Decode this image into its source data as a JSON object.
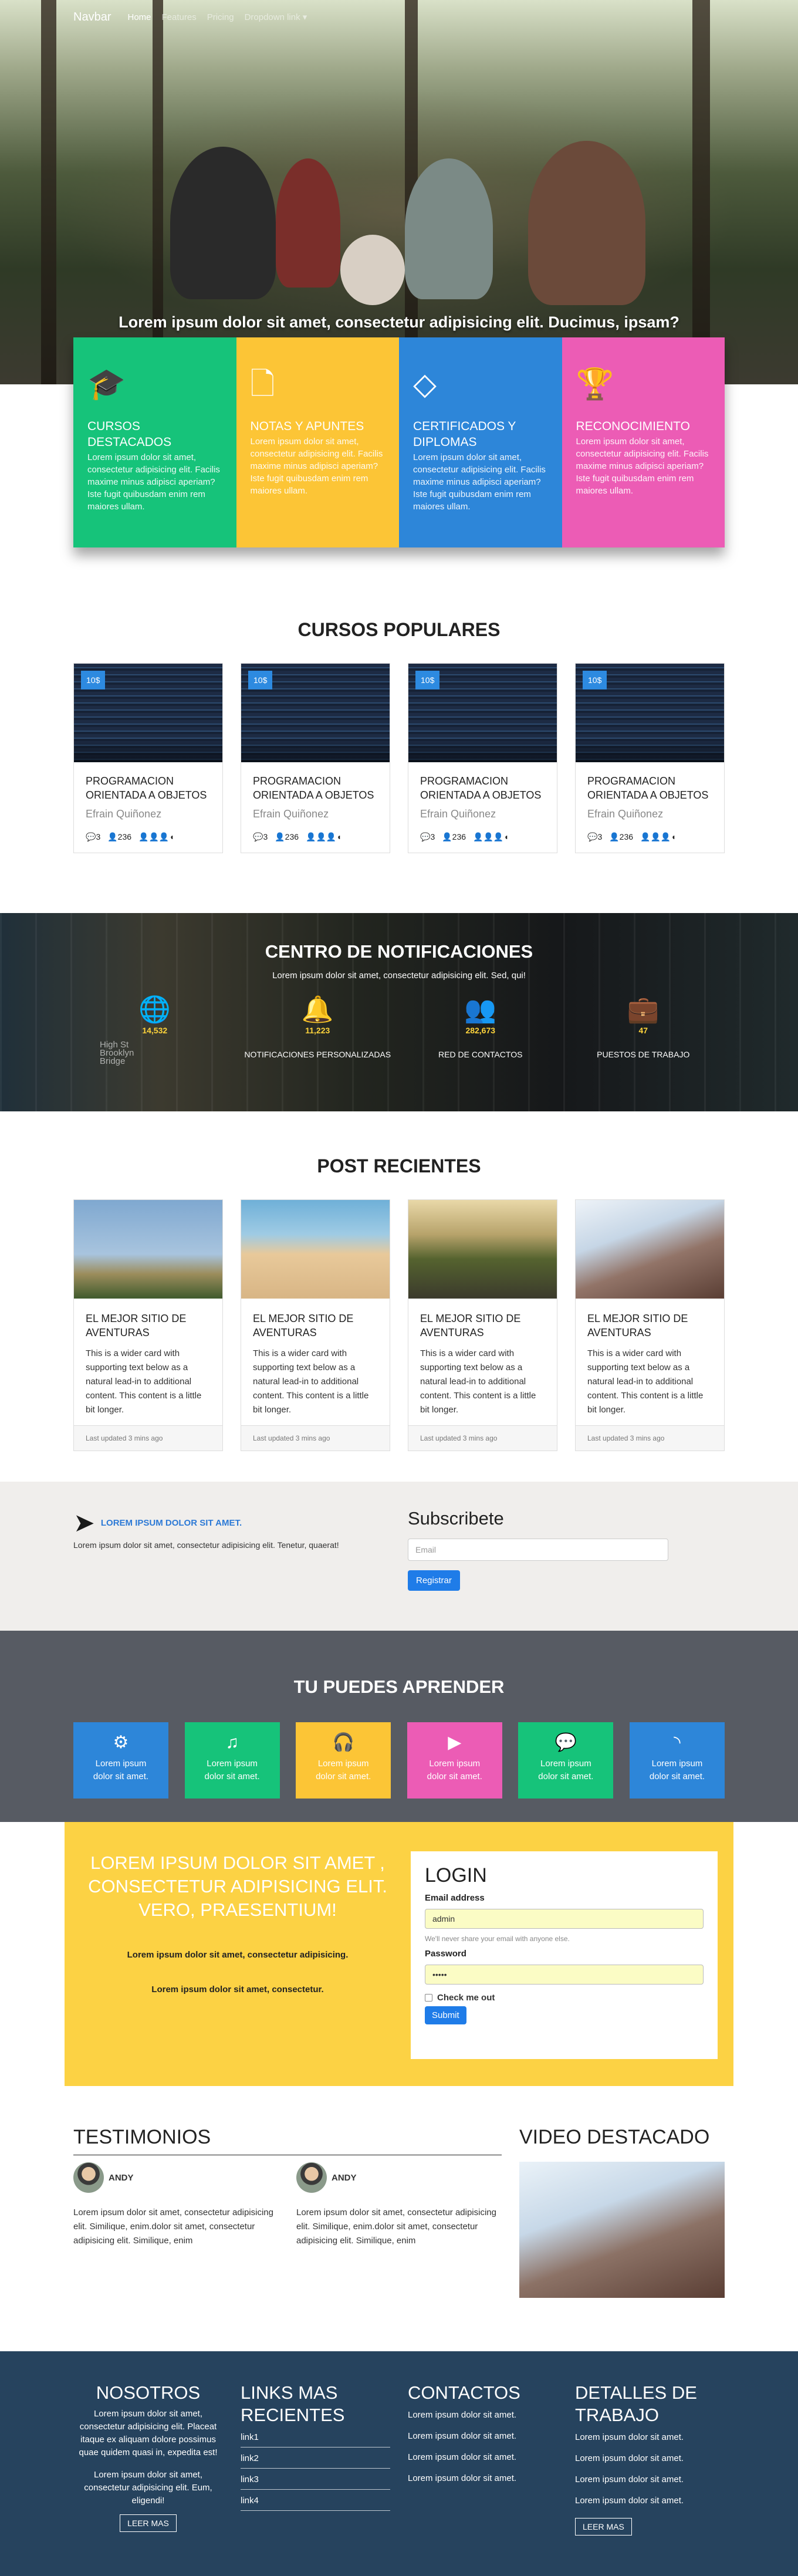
{
  "navbar": {
    "brand": "Navbar",
    "links": [
      "Home",
      "Features",
      "Pricing",
      "Dropdown link ▾"
    ]
  },
  "hero": {
    "title": "Lorem ipsum dolor sit amet, consectetur adipisicing elit. Ducimus, ipsam?"
  },
  "features": [
    {
      "title": "CURSOS DESTACADOS",
      "text": "Lorem ipsum dolor sit amet, consectetur adipisicing elit. Facilis maxime minus adipisci aperiam? Iste fugit quibusdam enim rem maiores ullam.",
      "color": "#16c37a",
      "icon": "graduation-cap-icon"
    },
    {
      "title": "NOTAS Y APUNTES",
      "text": "Lorem ipsum dolor sit amet, consectetur adipisicing elit. Facilis maxime minus adipisci aperiam? Iste fugit quibusdam enim rem maiores ullam.",
      "color": "#fcc536",
      "icon": "file-icon"
    },
    {
      "title": "CERTIFICADOS Y DIPLOMAS",
      "text": "Lorem ipsum dolor sit amet, consectetur adipisicing elit. Facilis maxime minus adipisci aperiam? Iste fugit quibusdam enim rem maiores ullam.",
      "color": "#2d86d9",
      "icon": "diamond-icon"
    },
    {
      "title": "RECONOCIMIENTO",
      "text": "Lorem ipsum dolor sit amet, consectetur adipisicing elit. Facilis maxime minus adipisci aperiam? Iste fugit quibusdam enim rem maiores ullam.",
      "color": "#ec5cb5",
      "icon": "trophy-icon"
    }
  ],
  "courses": {
    "title": "CURSOS POPULARES",
    "items": [
      {
        "price": "10$",
        "title": "PROGRAMACION ORIENTADA A OBJETOS",
        "author": "Efrain Quiñonez",
        "comments": "3",
        "students": "236"
      },
      {
        "price": "10$",
        "title": "PROGRAMACION ORIENTADA A OBJETOS",
        "author": "Efrain Quiñonez",
        "comments": "3",
        "students": "236"
      },
      {
        "price": "10$",
        "title": "PROGRAMACION ORIENTADA A OBJETOS",
        "author": "Efrain Quiñonez",
        "comments": "3",
        "students": "236"
      },
      {
        "price": "10$",
        "title": "PROGRAMACION ORIENTADA A OBJETOS",
        "author": "Efrain Quiñonez",
        "comments": "3",
        "students": "236"
      }
    ]
  },
  "notifications": {
    "title": "CENTRO DE NOTIFICACIONES",
    "subtitle": "Lorem ipsum dolor sit amet, consectetur adipisicing elit. Sed, qui!",
    "sign": "High St\nBrooklyn\nBridge",
    "stats": [
      {
        "num": "14,532",
        "label": "",
        "icon": "globe-icon"
      },
      {
        "num": "11,223",
        "label": "NOTIFICACIONES PERSONALIZADAS",
        "icon": "bell-icon"
      },
      {
        "num": "282,673",
        "label": "RED DE CONTACTOS",
        "icon": "users-icon"
      },
      {
        "num": "47",
        "label": "PUESTOS DE TRABAJO",
        "icon": "briefcase-icon"
      }
    ]
  },
  "posts": {
    "title": "POST RECIENTES",
    "items": [
      {
        "title": "EL MEJOR SITIO DE AVENTURAS",
        "text": "This is a wider card with supporting text below as a natural lead-in to additional content. This content is a little bit longer.",
        "updated": "Last updated 3 mins ago"
      },
      {
        "title": "EL MEJOR SITIO DE AVENTURAS",
        "text": "This is a wider card with supporting text below as a natural lead-in to additional content. This content is a little bit longer.",
        "updated": "Last updated 3 mins ago"
      },
      {
        "title": "EL MEJOR SITIO DE AVENTURAS",
        "text": "This is a wider card with supporting text below as a natural lead-in to additional content. This content is a little bit longer.",
        "updated": "Last updated 3 mins ago"
      },
      {
        "title": "EL MEJOR SITIO DE AVENTURAS",
        "text": "This is a wider card with supporting text below as a natural lead-in to additional content. This content is a little bit longer.",
        "updated": "Last updated 3 mins ago"
      }
    ]
  },
  "subscribe": {
    "label": "LOREM IPSUM DOLOR SIT AMET.",
    "text": "Lorem ipsum dolor sit amet, consectetur adipisicing elit. Tenetur, quaerat!",
    "title": "Subscribete",
    "email_placeholder": "Email",
    "button": "Registrar"
  },
  "learn": {
    "title": "TU PUEDES APRENDER",
    "tiles": [
      {
        "text": "Lorem ipsum dolor sit amet.",
        "color": "#2d86d9",
        "icon": "gear-icon"
      },
      {
        "text": "Lorem ipsum dolor sit amet.",
        "color": "#16c37a",
        "icon": "music-icon"
      },
      {
        "text": "Lorem ipsum dolor sit amet.",
        "color": "#fcc536",
        "icon": "headphones-icon"
      },
      {
        "text": "Lorem ipsum dolor sit amet.",
        "color": "#ec5cb5",
        "icon": "play-icon"
      },
      {
        "text": "Lorem ipsum dolor sit amet.",
        "color": "#16c37a",
        "icon": "comment-icon"
      },
      {
        "text": "Lorem ipsum dolor sit amet.",
        "color": "#2d86d9",
        "icon": "rss-icon"
      }
    ]
  },
  "login_section": {
    "headline": "LOREM IPSUM DOLOR SIT AMET , CONSECTETUR ADIPISICING ELIT. VERO, PRAESENTIUM!",
    "line1": "Lorem ipsum dolor sit amet, consectetur adipisicing.",
    "line2": "Lorem ipsum dolor sit amet, consectetur.",
    "form": {
      "title": "LOGIN",
      "email_label": "Email address",
      "email_value": "admin",
      "email_hint": "We'll never share your email with anyone else.",
      "password_label": "Password",
      "password_value": "•••••",
      "check_label": "Check me out",
      "submit": "Submit"
    }
  },
  "testimonials": {
    "title": "TESTIMONIOS",
    "items": [
      {
        "name": "ANDY",
        "text": "Lorem ipsum dolor sit amet, consectetur adipisicing elit. Similique, enim.dolor sit amet, consectetur adipisicing elit. Similique, enim"
      },
      {
        "name": "ANDY",
        "text": "Lorem ipsum dolor sit amet, consectetur adipisicing elit. Similique, enim.dolor sit amet, consectetur adipisicing elit. Similique, enim"
      }
    ],
    "video_title": "VIDEO DESTACADO"
  },
  "footer": {
    "nosotros": {
      "title": "NOSOTROS",
      "p1": "Lorem ipsum dolor sit amet, consectetur adipisicing elit. Placeat itaque ex aliquam dolore possimus quae quidem quasi in, expedita est!",
      "p2": "Lorem ipsum dolor sit amet, consectetur adipisicing elit. Eum, eligendi!",
      "button": "LEER MAS"
    },
    "links": {
      "title": "LINKS MAS RECIENTES",
      "items": [
        "link1",
        "link2",
        "link3",
        "link4"
      ]
    },
    "contactos": {
      "title": "CONTACTOS",
      "items": [
        "Lorem ipsum dolor sit amet.",
        "Lorem ipsum dolor sit amet.",
        "Lorem ipsum dolor sit amet.",
        "Lorem ipsum dolor sit amet."
      ]
    },
    "trabajo": {
      "title": "DETALLES DE TRABAJO",
      "items": [
        "Lorem ipsum dolor sit amet.",
        "Lorem ipsum dolor sit amet.",
        "Lorem ipsum dolor sit amet.",
        "Lorem ipsum dolor sit amet."
      ],
      "button": "LEER MAS"
    }
  }
}
